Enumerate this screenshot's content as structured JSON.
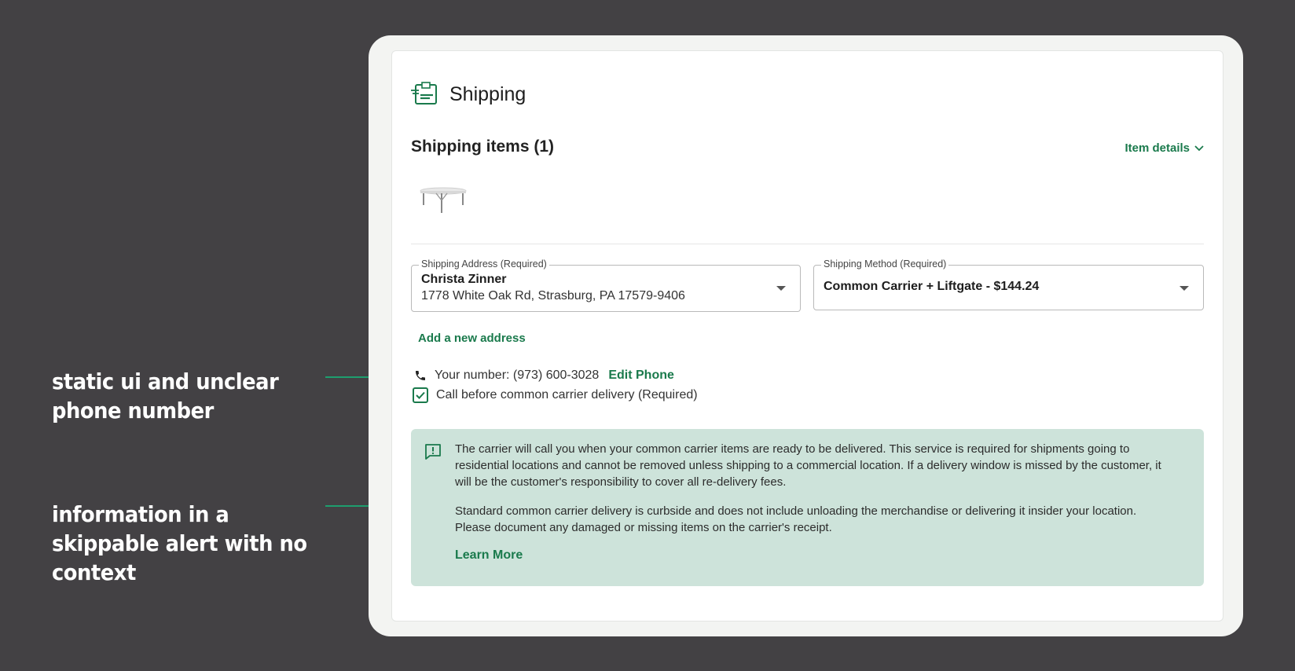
{
  "annotations": [
    {
      "text": "static ui and unclear phone number"
    },
    {
      "text": "information in a skippable alert with no context"
    }
  ],
  "colors": {
    "accent": "#1a7a4c",
    "annotation_marker": "#1e9e6e",
    "alert_bg": "#cde3da",
    "backdrop": "#434144"
  },
  "shipping": {
    "title": "Shipping",
    "icon": "shipping-box-icon",
    "items_heading": "Shipping items (1)",
    "item_details_label": "Item details",
    "item_thumbnail": "folding-table-image",
    "address_field": {
      "label": "Shipping Address (Required)",
      "name": "Christa Zinner",
      "address": "1778 White Oak Rd, Strasburg, PA 17579-9406"
    },
    "method_field": {
      "label": "Shipping Method (Required)",
      "value": "Common Carrier + Liftgate - $144.24"
    },
    "add_address_label": "Add a new address",
    "phone": {
      "text": "Your number: (973) 600-3028",
      "edit_label": "Edit Phone",
      "icon": "phone-icon"
    },
    "call_before": {
      "label": "Call before common carrier delivery (Required)",
      "checked": true
    },
    "alert": {
      "icon": "alert-message-icon",
      "paragraph1": "The carrier will call you when your common carrier items are ready to be delivered. This service is required for shipments going to residential locations and cannot be removed unless shipping to a commercial location. If a delivery window is missed by the customer, it will be the customer's responsibility to cover all re-delivery fees.",
      "paragraph2": "Standard common carrier delivery is curbside and does not include unloading the merchandise or delivering it insider your location. Please document any damaged or missing items on the carrier's receipt.",
      "learn_more_label": "Learn More"
    }
  }
}
